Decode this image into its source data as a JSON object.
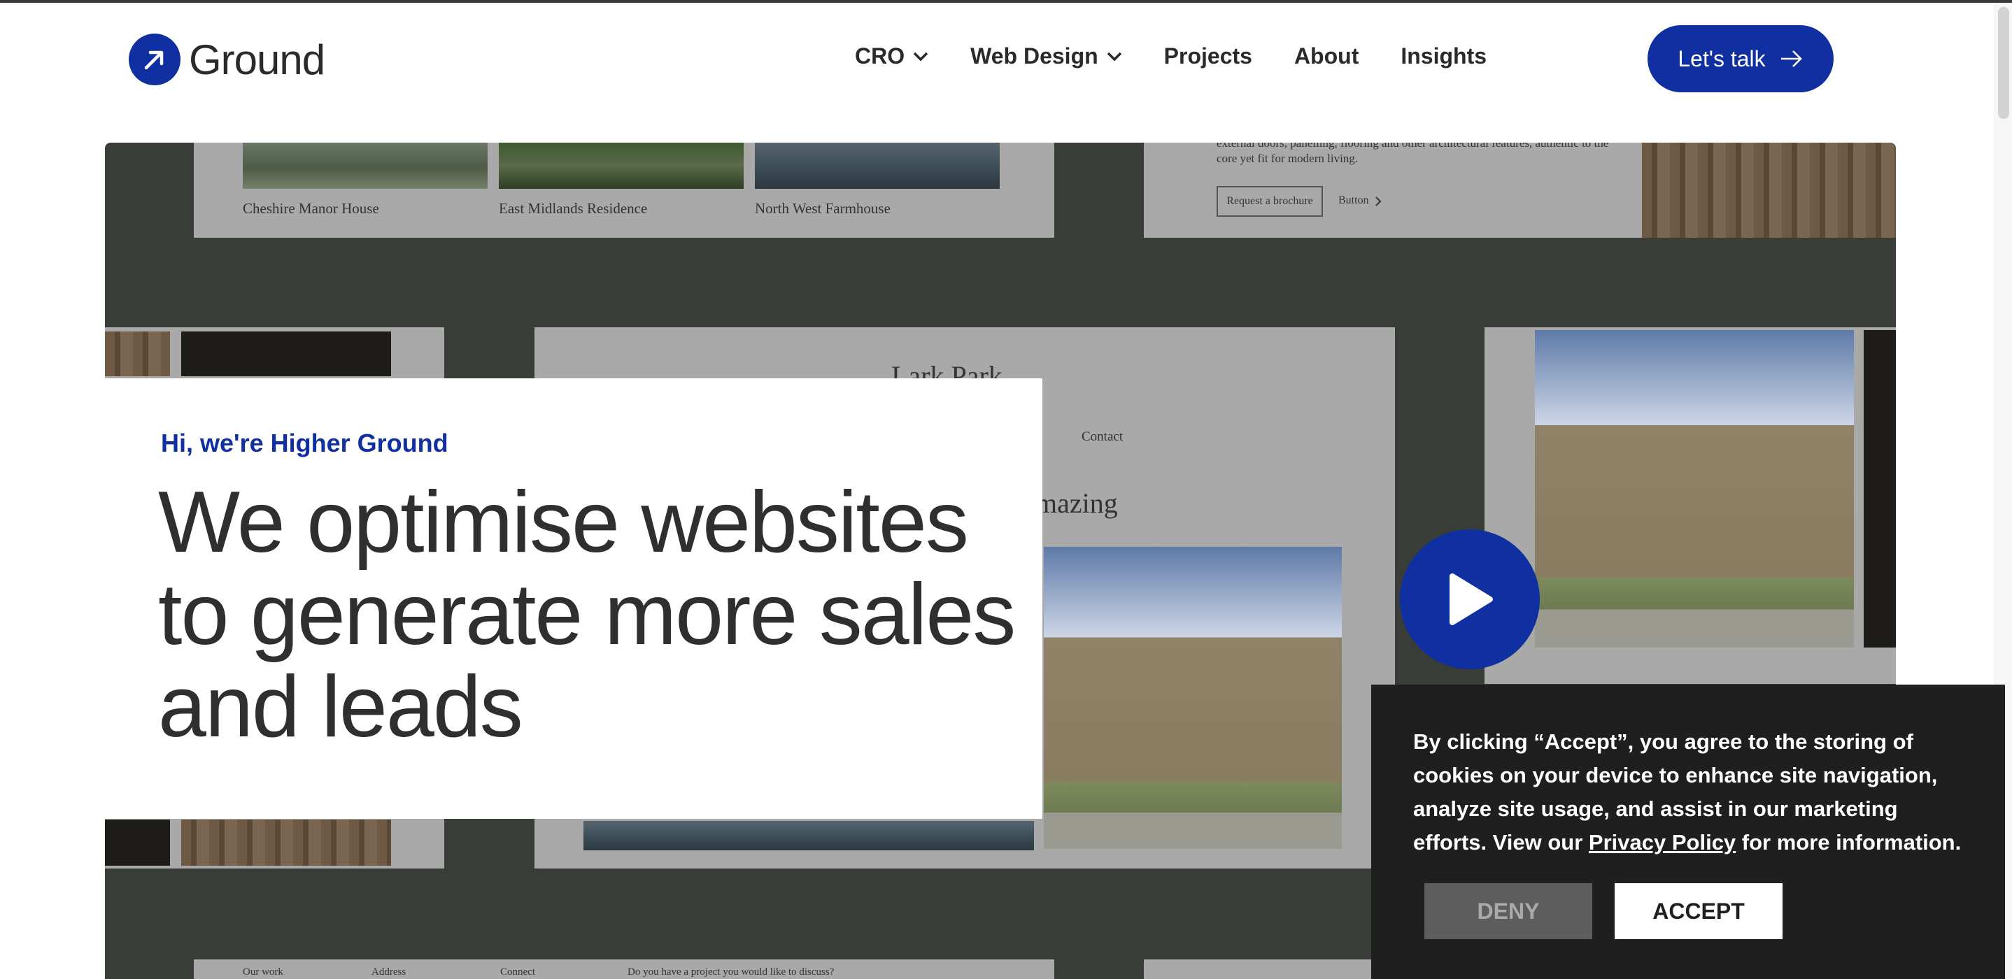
{
  "header": {
    "logo_text": "Ground",
    "nav": [
      {
        "label": "CRO",
        "dropdown": true
      },
      {
        "label": "Web Design",
        "dropdown": true
      },
      {
        "label": "Projects",
        "dropdown": false
      },
      {
        "label": "About",
        "dropdown": false
      },
      {
        "label": "Insights",
        "dropdown": false
      }
    ],
    "cta_label": "Let's talk"
  },
  "colors": {
    "brand": "#102fa0",
    "hero_bg": "#393d38",
    "cookie_bg": "#1f1f1f"
  },
  "hero": {
    "eyebrow": "Hi, we're Higher Ground",
    "headline": "We optimise websites to generate more sales and leads",
    "mockup": {
      "captions": [
        "Cheshire Manor House",
        "East Midlands Residence",
        "North West Farmhouse"
      ],
      "brochure_text": "external doors, panelling, flooring and other architectural features, authentic to the core yet fit for modern living.",
      "brochure_button": "Request a brochure",
      "link_button": "Button",
      "nav_contact": "Contact",
      "fragment_word": "mazing",
      "footer_cols": [
        "Our work",
        "Address",
        "Connect",
        "Do you have a project you would like to discuss?"
      ]
    },
    "play_icon": "play-icon"
  },
  "cookie": {
    "text_before": "By clicking “Accept”, you agree to the storing of cookies on your device to enhance site navigation, analyze site usage, and assist in our marketing efforts. View our ",
    "link": "Privacy Policy",
    "text_after": " for more information.",
    "deny_label": "DENY",
    "accept_label": "ACCEPT"
  }
}
